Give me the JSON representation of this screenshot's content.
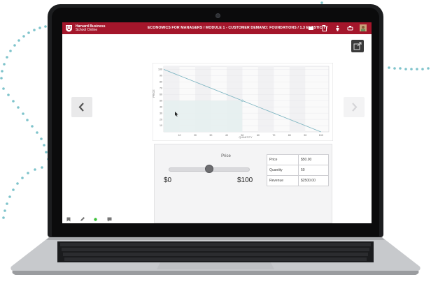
{
  "header": {
    "brand_line1": "Harvard Business",
    "brand_line2": "School Online",
    "breadcrumb": "ECONOMICS FOR MANAGERS / MODULE 1 - CUSTOMER DEMAND: FOUNDATIONS / 1.3 ELASTICITY",
    "icons": [
      "notes-icon",
      "document-icon",
      "person-raise-hand-icon",
      "print-icon",
      "profile-avatar-icon"
    ]
  },
  "chart_data": {
    "type": "line",
    "xlabel": "QUANTITY",
    "ylabel": "PRICE",
    "x_ticks": [
      10,
      20,
      30,
      40,
      50,
      60,
      70,
      80,
      90,
      100
    ],
    "y_ticks": [
      10,
      20,
      30,
      40,
      50,
      60,
      70,
      80,
      90,
      100
    ],
    "xlim": [
      0,
      105
    ],
    "ylim": [
      0,
      105
    ],
    "series": [
      {
        "x": [
          0,
          100
        ],
        "y": [
          100,
          0
        ]
      }
    ],
    "highlight": {
      "quantity": 50,
      "price": 50
    },
    "grid": true
  },
  "controls": {
    "price_label": "Price",
    "slider_min_label": "$0",
    "slider_max_label": "$100",
    "slider_value": 0.5,
    "table": [
      {
        "key": "Price",
        "value": "$50.00"
      },
      {
        "key": "Quantity",
        "value": "50"
      },
      {
        "key": "Revenue",
        "value": "$2500.00"
      }
    ]
  },
  "colors": {
    "header": "#a4162b",
    "line": "#7fb6c2",
    "shaded_area": "#e6f0ef",
    "dots": "#6bb8c2",
    "status_dot": "#3fc13c"
  }
}
